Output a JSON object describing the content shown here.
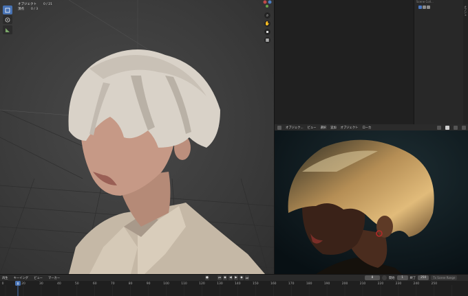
{
  "viewport": {
    "info_line1_label": "オブジェクト",
    "info_line1_value": "0 / 21",
    "info_line2_label": "頂点",
    "info_line2_value": "0 / 3"
  },
  "nav_gizmos": [
    "zoom-icon",
    "pan-hand-icon",
    "camera-icon",
    "grid-view-icon"
  ],
  "outliner": {
    "row_label": "Scene Coll..."
  },
  "props_side_label": "オブジェ",
  "render_header": {
    "mode": "オブジェク...",
    "menus": [
      "ビュー",
      "選択",
      "追加",
      "オブジェクト"
    ],
    "orientation": "ローカ"
  },
  "timeline_header": {
    "menus": [
      "再生",
      "キーイング",
      "ビュー",
      "マーカー"
    ],
    "current_frame": "8",
    "start_label": "開始",
    "start_value": "1",
    "end_label": "終了",
    "end_value": "250",
    "scene_label": "Tx Scene Range"
  },
  "timeline": {
    "frames": [
      "0",
      "20",
      "30",
      "40",
      "50",
      "60",
      "70",
      "80",
      "90",
      "100",
      "110",
      "120",
      "130",
      "140",
      "150",
      "160",
      "170",
      "180",
      "190",
      "200",
      "210",
      "220",
      "230",
      "240",
      "250"
    ],
    "playhead_frame": 8
  },
  "colors": {
    "accent": "#4772b3",
    "playhead": "#4772b3"
  }
}
